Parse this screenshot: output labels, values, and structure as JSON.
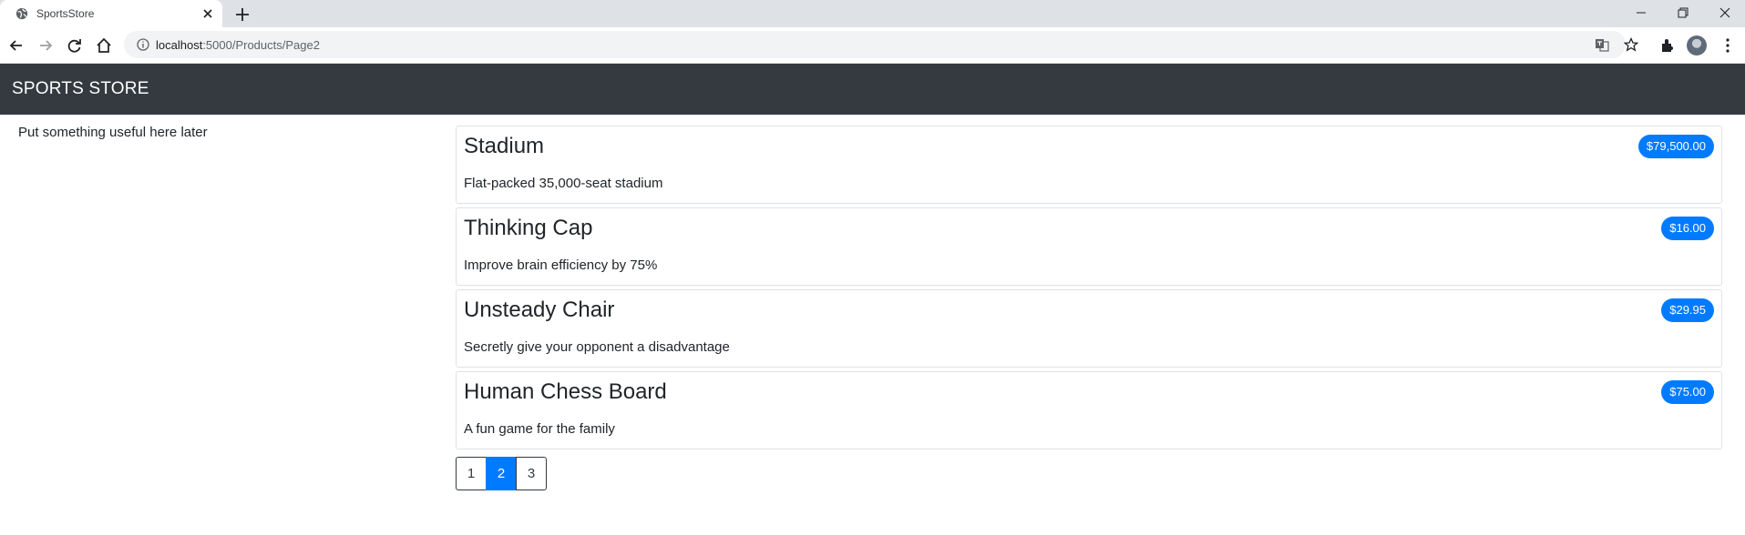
{
  "browser": {
    "tab_title": "SportsStore",
    "url_host": "localhost",
    "url_path": ":5000/Products/Page2"
  },
  "navbar": {
    "brand": "SPORTS STORE",
    "bg_color": "#343a40"
  },
  "sidebar": {
    "text": "Put something useful here later"
  },
  "products": [
    {
      "name": "Stadium",
      "price": "$79,500.00",
      "description": "Flat-packed 35,000-seat stadium"
    },
    {
      "name": "Thinking Cap",
      "price": "$16.00",
      "description": "Improve brain efficiency by 75%"
    },
    {
      "name": "Unsteady Chair",
      "price": "$29.95",
      "description": "Secretly give your opponent a disadvantage"
    },
    {
      "name": "Human Chess Board",
      "price": "$75.00",
      "description": "A fun game for the family"
    }
  ],
  "pagination": {
    "pages": [
      "1",
      "2",
      "3"
    ],
    "current": "2"
  },
  "colors": {
    "accent": "#007bff"
  }
}
